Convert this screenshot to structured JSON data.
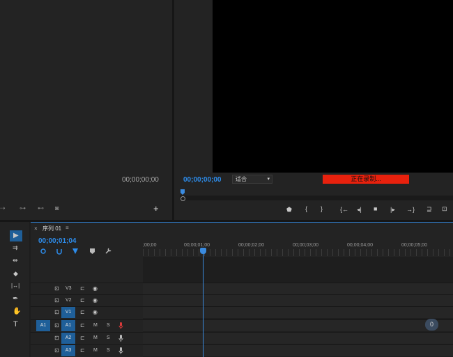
{
  "source_monitor": {
    "timecode": "00;00;00;00",
    "bottom_icons": [
      "insert-icon",
      "export-frame-icon",
      "overwrite-icon",
      "camera-icon"
    ],
    "add_label": "+"
  },
  "program_monitor": {
    "timecode": "00;00;00;00",
    "fit_label": "适合",
    "fit_caret": "▾",
    "recording_label": "正在录制...",
    "controls": {
      "marker": "⬟",
      "mark_in": "{",
      "mark_out": "}",
      "go_to_in": "{←",
      "step_back": "◂|",
      "stop": "■",
      "step_forward": "|▸",
      "go_to_out": "→}",
      "lift": "⊒",
      "extract": "⊡"
    }
  },
  "tools": [
    "▶",
    "⇉",
    "⇹",
    "◆",
    "|↔|",
    "✒",
    "✋",
    "T"
  ],
  "timeline": {
    "close": "×",
    "sequence_name": "序列 01",
    "menu": "≡",
    "timecode": "00;00;01;04",
    "ruler_labels": [
      ";00;00",
      "00;00;01;00",
      "00;00;02;00",
      "00;00;03;00",
      "00;00;04;00",
      "00;00;05;00"
    ],
    "video_tracks": [
      {
        "name": "V3",
        "lock": "⊡",
        "sync": "⊏",
        "eye": "◉"
      },
      {
        "name": "V2",
        "lock": "⊡",
        "sync": "⊏",
        "eye": "◉"
      },
      {
        "name": "V1",
        "lock": "⊡",
        "sync": "⊏",
        "eye": "◉"
      }
    ],
    "audio_tracks": [
      {
        "src": "A1",
        "name": "A1",
        "m": "M",
        "s": "S"
      },
      {
        "name": "A2",
        "m": "M",
        "s": "S"
      },
      {
        "name": "A3",
        "m": "M",
        "s": "S"
      }
    ],
    "badge": "0"
  }
}
